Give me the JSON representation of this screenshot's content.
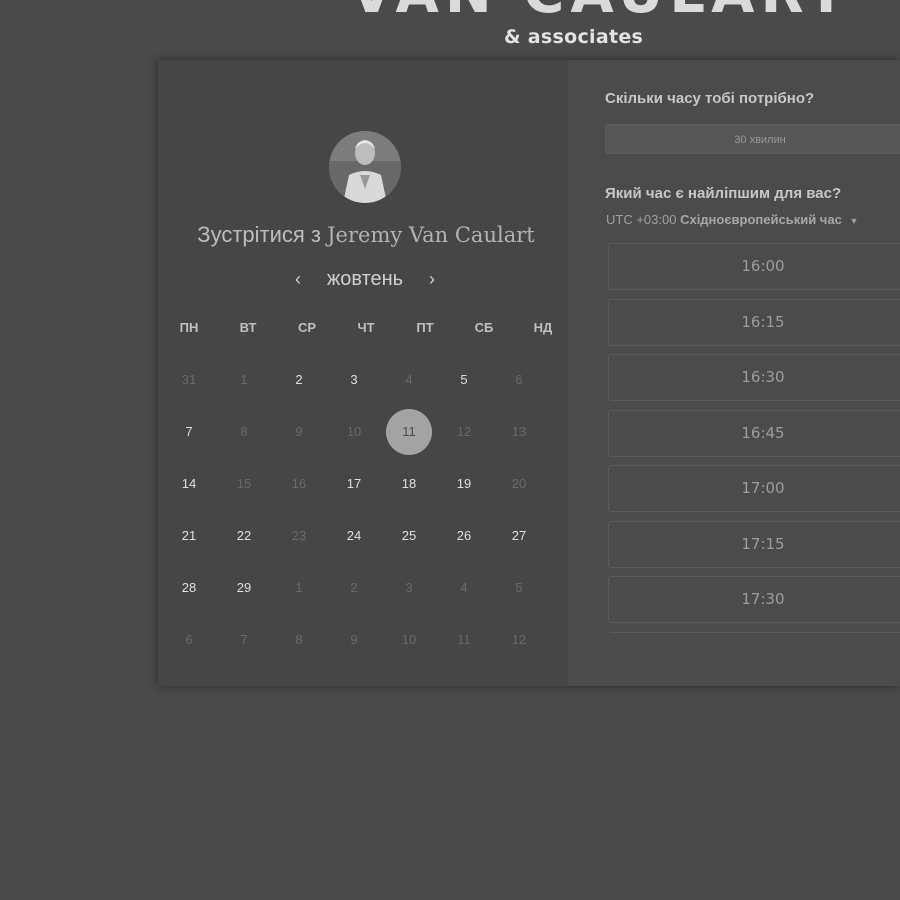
{
  "brand": {
    "title": "VAN CAULART",
    "subtitle": "& associates"
  },
  "host": {
    "meet_prefix": "Зустрітися з",
    "name": "Jeremy Van Caulart"
  },
  "calendar": {
    "month": "жовтень",
    "weekdays": [
      "ПН",
      "ВТ",
      "СР",
      "ЧТ",
      "ПТ",
      "СБ",
      "НД"
    ],
    "weeks": [
      [
        {
          "d": "31",
          "m": true
        },
        {
          "d": "1",
          "m": true
        },
        {
          "d": "2",
          "m": false
        },
        {
          "d": "3",
          "m": false
        },
        {
          "d": "4",
          "m": true
        },
        {
          "d": "5",
          "m": false
        },
        {
          "d": "6",
          "m": true
        }
      ],
      [
        {
          "d": "7",
          "m": false
        },
        {
          "d": "8",
          "m": true
        },
        {
          "d": "9",
          "m": true
        },
        {
          "d": "10",
          "m": true
        },
        {
          "d": "11",
          "m": false,
          "selected": true
        },
        {
          "d": "12",
          "m": true
        },
        {
          "d": "13",
          "m": true
        }
      ],
      [
        {
          "d": "14",
          "m": false
        },
        {
          "d": "15",
          "m": true
        },
        {
          "d": "16",
          "m": true
        },
        {
          "d": "17",
          "m": false
        },
        {
          "d": "18",
          "m": false
        },
        {
          "d": "19",
          "m": false
        },
        {
          "d": "20",
          "m": true
        }
      ],
      [
        {
          "d": "21",
          "m": false
        },
        {
          "d": "22",
          "m": false
        },
        {
          "d": "23",
          "m": true
        },
        {
          "d": "24",
          "m": false
        },
        {
          "d": "25",
          "m": false
        },
        {
          "d": "26",
          "m": false
        },
        {
          "d": "27",
          "m": false
        }
      ],
      [
        {
          "d": "28",
          "m": false
        },
        {
          "d": "29",
          "m": false
        },
        {
          "d": "1",
          "m": true
        },
        {
          "d": "2",
          "m": true
        },
        {
          "d": "3",
          "m": true
        },
        {
          "d": "4",
          "m": true
        },
        {
          "d": "5",
          "m": true
        }
      ],
      [
        {
          "d": "6",
          "m": true
        },
        {
          "d": "7",
          "m": true
        },
        {
          "d": "8",
          "m": true
        },
        {
          "d": "9",
          "m": true
        },
        {
          "d": "10",
          "m": true
        },
        {
          "d": "11",
          "m": true
        },
        {
          "d": "12",
          "m": true
        }
      ]
    ]
  },
  "booking": {
    "duration_question": "Скільки часу тобі потрібно?",
    "duration_value": "30 хвилин",
    "time_question": "Який час є найліпшим для вас?",
    "tz_offset": "UTC +03:00",
    "tz_name": "Східноєвропейський час",
    "slots": [
      "16:00",
      "16:15",
      "16:30",
      "16:45",
      "17:00",
      "17:15",
      "17:30",
      ""
    ]
  },
  "icons": {
    "prev": "chevron-left-icon",
    "next": "chevron-right-icon",
    "tz_caret": "caret-down-icon"
  }
}
